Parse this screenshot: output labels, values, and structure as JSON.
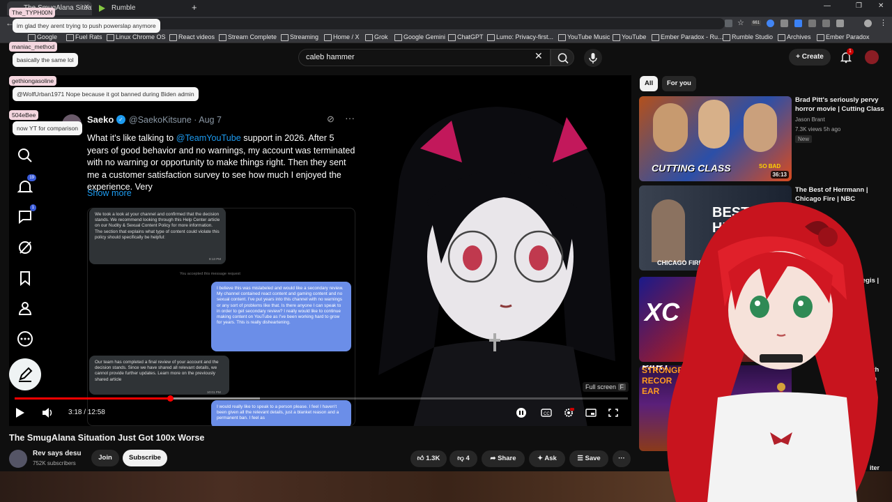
{
  "browser": {
    "tabs": [
      {
        "label": "The SmugAlana Situation Just Got 100x Worse"
      },
      {
        "label": "Rumble"
      }
    ],
    "bookmarks": [
      "Google",
      "Fuel Rats",
      "Linux Chrome OS",
      "React videos",
      "Stream Complete",
      "Streaming",
      "Home / X",
      "Grok",
      "Google Gemini",
      "ChatGPT",
      "Lumo: Privacy-first...",
      "YouTube Music",
      "YouTube",
      "Ember Paradox - Ru...",
      "Rumble Studio",
      "Archives",
      "Ember Paradox"
    ],
    "ext_badge": "661"
  },
  "header": {
    "search_value": "caleb hammer",
    "create_label": "Create",
    "notif_count": "1"
  },
  "chat": [
    {
      "name": "The_TYPH00N",
      "message": "im glad they arent trying to push powerslap anymore"
    },
    {
      "name": "maniac_method",
      "message": "basically the same lol"
    },
    {
      "name": "gethiongasoline",
      "message": "@WolfUrban1971 Nope because it got banned during Biden admin"
    },
    {
      "name": "504eBee",
      "message": "now YT for comparison"
    }
  ],
  "rail": {
    "notif_badge": "19",
    "msg_badge": "1"
  },
  "tweet": {
    "display_name": "Saeko",
    "handle": "@SaekoKitsune · Aug 7",
    "text_before": "What it's like talking to ",
    "mention": "@TeamYouTube",
    "text_after": "  support in 2026. After 5 years of good behavior and no warnings, my account was terminated with no warning or opportunity to make things right. Then they sent me a customer satisfaction survey to see how much I enjoyed the experience. Very",
    "show_more": "Show more",
    "messages": [
      {
        "side": "gray",
        "text": "We took a look at your channel and confirmed that the decision stands. We recommend looking through this Help Center article on our Nudity & Sexual Content Policy for more information. The section that explains what type of content could violate this policy should specifically be helpful:",
        "time": "8:13 PM"
      },
      {
        "side": "note",
        "text": "You accepted this message request"
      },
      {
        "side": "blue",
        "text": "I believe this was mislabeled and would like a secondary review. My channel contained react content and gaming content and no sexual content. I've put years into this channel with no warnings or any sort of problems like that. Is there anyone I can speak to in order to get secondary review? I really would like to continue making content on YouTube as I've been working hard to grow for years. This is really disheartening."
      },
      {
        "side": "gray",
        "text": "Our team has completed a final review of your account and the decision stands. Since we have shared all relevant details, we cannot provide further updates. Learn more on the previously shared article",
        "time": "10:01 PM"
      },
      {
        "side": "blue",
        "text": "I would really like to speak to a person please. I feel I haven't been given all the relevant details, just a blanket reason and a permanent ban. I feel as"
      }
    ]
  },
  "player": {
    "time": "3:18 / 12:58",
    "progress_fraction": 0.253,
    "buffer_fraction": 0.4,
    "fullscreen_tip": "Full screen",
    "fullscreen_key": "F"
  },
  "video": {
    "title": "The SmugAlana Situation Just Got 100x Worse",
    "channel": "Rev says desu",
    "subscribers": "752K subscribers",
    "join_label": "Join",
    "subscribe_label": "Subscribe",
    "likes": "1.3K",
    "dislikes": "4",
    "share_label": "Share",
    "ask_label": "Ask",
    "save_label": "Save"
  },
  "sidebar": {
    "chips": [
      "All",
      "For you"
    ],
    "recs": [
      {
        "title": "Brad Pitt's seriously pervy horror movie | Cutting Class",
        "channel": "Jason Brant",
        "meta": "7.3K views 5h ago",
        "badge": "New",
        "duration": "36:13",
        "thumb_text": "CUTTING CLASS",
        "thumb_corner": "SO BAD"
      },
      {
        "title": "The Best of Herrmann | Chicago Fire | NBC",
        "thumb_text": "BEST OF HERR",
        "thumb_sub": "CHICAGO FIRE"
      },
      {
        "title_fragment": "Aegis |",
        "thumb_text": "XC"
      },
      {
        "title_fragment": "Earth",
        "title_fragment2": "ll On",
        "thumb_text": "S2 PLAY PART",
        "thumb_sub": "STRONGEST RECOR EAR"
      }
    ],
    "bottom_fragment": "iter"
  },
  "colors": {
    "accent": "#ff0000",
    "blue_bubble": "#6b8ee8",
    "hair_red": "#c8141e"
  }
}
